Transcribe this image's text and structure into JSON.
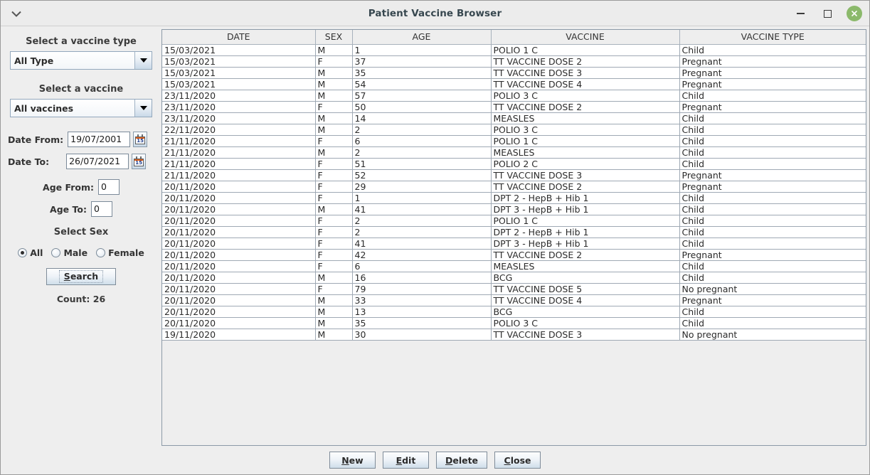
{
  "window": {
    "title": "Patient Vaccine Browser",
    "collapse_icon": "chevron-down-icon",
    "controls": {
      "minimize": "minimize-icon",
      "maximize": "maximize-icon",
      "close": "close-icon"
    },
    "close_color": "#8bb96b"
  },
  "sidebar": {
    "vaccine_type_heading": "Select a vaccine type",
    "vaccine_type_value": "All Type",
    "vaccine_heading": "Select a vaccine",
    "vaccine_value": "All vaccines",
    "date_from_label": "Date From:",
    "date_from_value": "19/07/2001",
    "date_to_label": "Date To:",
    "date_to_value": "26/07/2021",
    "calendar_icon_day": "15",
    "age_from_label": "Age From:",
    "age_from_value": "0",
    "age_to_label": "Age To:",
    "age_to_value": "0",
    "sex_heading": "Select Sex",
    "sex_options": [
      {
        "label": "All",
        "selected": true
      },
      {
        "label": "Male",
        "selected": false
      },
      {
        "label": "Female",
        "selected": false
      }
    ],
    "search_button": {
      "mnemonic": "S",
      "rest": "earch"
    },
    "count_text": "Count: 26"
  },
  "table": {
    "columns": [
      "DATE",
      "SEX",
      "AGE",
      "VACCINE",
      "VACCINE TYPE"
    ],
    "rows": [
      [
        "15/03/2021",
        "M",
        "1",
        "POLIO 1 C",
        "Child"
      ],
      [
        "15/03/2021",
        "F",
        "37",
        "TT VACCINE DOSE 2",
        "Pregnant"
      ],
      [
        "15/03/2021",
        "M",
        "35",
        "TT VACCINE DOSE 3",
        "Pregnant"
      ],
      [
        "15/03/2021",
        "M",
        "54",
        "TT VACCINE DOSE 4",
        "Pregnant"
      ],
      [
        "23/11/2020",
        "M",
        "57",
        "POLIO 3 C",
        "Child"
      ],
      [
        "23/11/2020",
        "F",
        "50",
        "TT VACCINE DOSE 2",
        "Pregnant"
      ],
      [
        "23/11/2020",
        "M",
        "14",
        "MEASLES",
        "Child"
      ],
      [
        "22/11/2020",
        "M",
        "2",
        "POLIO 3 C",
        "Child"
      ],
      [
        "21/11/2020",
        "F",
        "6",
        "POLIO 1 C",
        "Child"
      ],
      [
        "21/11/2020",
        "M",
        "2",
        "MEASLES",
        "Child"
      ],
      [
        "21/11/2020",
        "F",
        "51",
        "POLIO 2 C",
        "Child"
      ],
      [
        "21/11/2020",
        "F",
        "52",
        "TT VACCINE DOSE 3",
        "Pregnant"
      ],
      [
        "20/11/2020",
        "F",
        "29",
        "TT VACCINE DOSE 2",
        "Pregnant"
      ],
      [
        "20/11/2020",
        "F",
        "1",
        "DPT 2 - HepB + Hib 1",
        "Child"
      ],
      [
        "20/11/2020",
        "M",
        "41",
        "DPT 3 - HepB + Hib 1",
        "Child"
      ],
      [
        "20/11/2020",
        "F",
        "2",
        "POLIO 1 C",
        "Child"
      ],
      [
        "20/11/2020",
        "F",
        "2",
        "DPT 2 - HepB + Hib 1",
        "Child"
      ],
      [
        "20/11/2020",
        "F",
        "41",
        "DPT 3 - HepB + Hib 1",
        "Child"
      ],
      [
        "20/11/2020",
        "F",
        "42",
        "TT VACCINE DOSE 2",
        "Pregnant"
      ],
      [
        "20/11/2020",
        "F",
        "6",
        "MEASLES",
        "Child"
      ],
      [
        "20/11/2020",
        "M",
        "16",
        "BCG",
        "Child"
      ],
      [
        "20/11/2020",
        "F",
        "79",
        "TT VACCINE DOSE 5",
        "No pregnant"
      ],
      [
        "20/11/2020",
        "M",
        "33",
        "TT VACCINE DOSE 4",
        "Pregnant"
      ],
      [
        "20/11/2020",
        "M",
        "13",
        "BCG",
        "Child"
      ],
      [
        "20/11/2020",
        "M",
        "35",
        "POLIO 3 C",
        "Child"
      ],
      [
        "19/11/2020",
        "M",
        "30",
        "TT VACCINE DOSE 3",
        "No pregnant"
      ]
    ]
  },
  "footer": {
    "buttons": [
      {
        "mnemonic": "N",
        "rest": "ew",
        "name": "new-button"
      },
      {
        "mnemonic": "E",
        "rest": "dit",
        "name": "edit-button"
      },
      {
        "mnemonic": "D",
        "rest": "elete",
        "name": "delete-button"
      },
      {
        "mnemonic": "C",
        "rest": "lose",
        "name": "close-button"
      }
    ]
  }
}
